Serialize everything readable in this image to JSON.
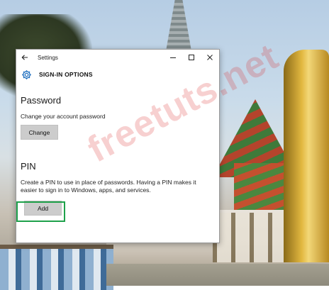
{
  "window": {
    "title": "Settings",
    "back_icon": "back-arrow-icon",
    "controls": {
      "minimize_icon": "minimize-icon",
      "maximize_icon": "maximize-icon",
      "close_icon": "close-icon"
    }
  },
  "header": {
    "icon": "gear-icon",
    "title": "SIGN-IN OPTIONS",
    "accent": "#1f6fbf"
  },
  "password": {
    "heading": "Password",
    "description": "Change your account password",
    "button_label": "Change"
  },
  "pin": {
    "heading": "PIN",
    "description_line1": "Create a PIN to use in place of passwords. Having a PIN makes it",
    "description_line2": "easier to sign in to Windows, apps, and services.",
    "button_label": "Add",
    "highlight_color": "#1fa14b"
  },
  "watermark": {
    "text": "freetuts.net",
    "color": "#dc2828"
  }
}
